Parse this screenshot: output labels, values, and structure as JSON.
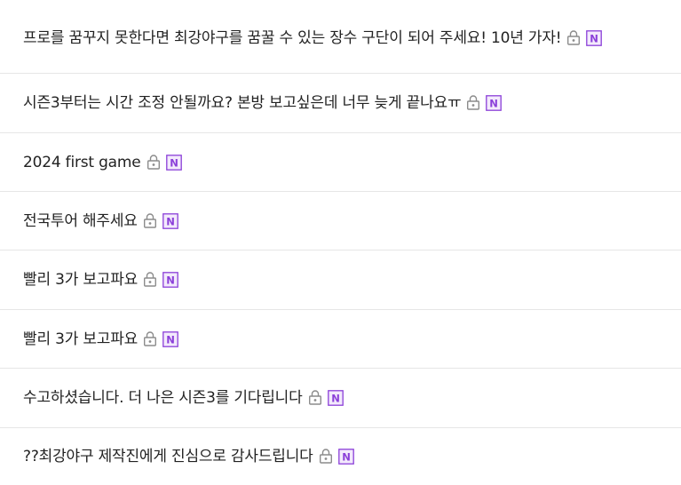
{
  "colors": {
    "lock_icon": "#8c8c8c",
    "new_badge": "#8b3fd9",
    "divider": "#e6e6e6",
    "text": "#222222"
  },
  "posts": [
    {
      "title": "프로를 꿈꾸지 못한다면 최강야구를 꿈꿀 수 있는 장수 구단이 되어 주세요! 10년 가자!",
      "locked": true,
      "new_badge": "N"
    },
    {
      "title": "시즌3부터는 시간 조정 안될까요? 본방 보고싶은데 너무 늦게 끝나요ㅠ",
      "locked": true,
      "new_badge": "N"
    },
    {
      "title": "2024 first game",
      "locked": true,
      "new_badge": "N"
    },
    {
      "title": "전국투어 해주세요",
      "locked": true,
      "new_badge": "N"
    },
    {
      "title": "빨리 3가 보고파요",
      "locked": true,
      "new_badge": "N"
    },
    {
      "title": "빨리 3가 보고파요",
      "locked": true,
      "new_badge": "N"
    },
    {
      "title": "수고하셨습니다. 더 나은 시즌3를 기다립니다",
      "locked": true,
      "new_badge": "N"
    },
    {
      "title": "??최강야구 제작진에게 진심으로 감사드립니다",
      "locked": true,
      "new_badge": "N"
    }
  ]
}
